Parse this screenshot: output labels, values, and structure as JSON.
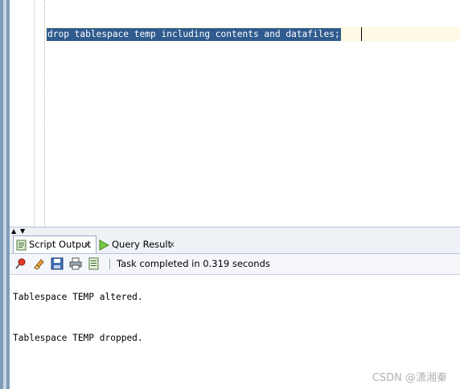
{
  "editor": {
    "code": "drop tablespace temp including contents and datafiles;"
  },
  "tabs": [
    {
      "label": "Script Output",
      "close": "x"
    },
    {
      "label": "Query Result",
      "close": "x"
    }
  ],
  "toolbar": {
    "icons": [
      "pin-icon",
      "eraser-icon",
      "save-icon",
      "print-icon",
      "export-icon"
    ],
    "status": "Task completed in 0.319 seconds"
  },
  "output": {
    "lines": [
      "Tablespace TEMP altered.",
      "Tablespace TEMP dropped."
    ]
  },
  "watermark": "CSDN @潇湘秦",
  "colors": {
    "selection": "#2f5b8e",
    "current_line": "#fefae6",
    "panel_bg": "#eef1f6"
  }
}
